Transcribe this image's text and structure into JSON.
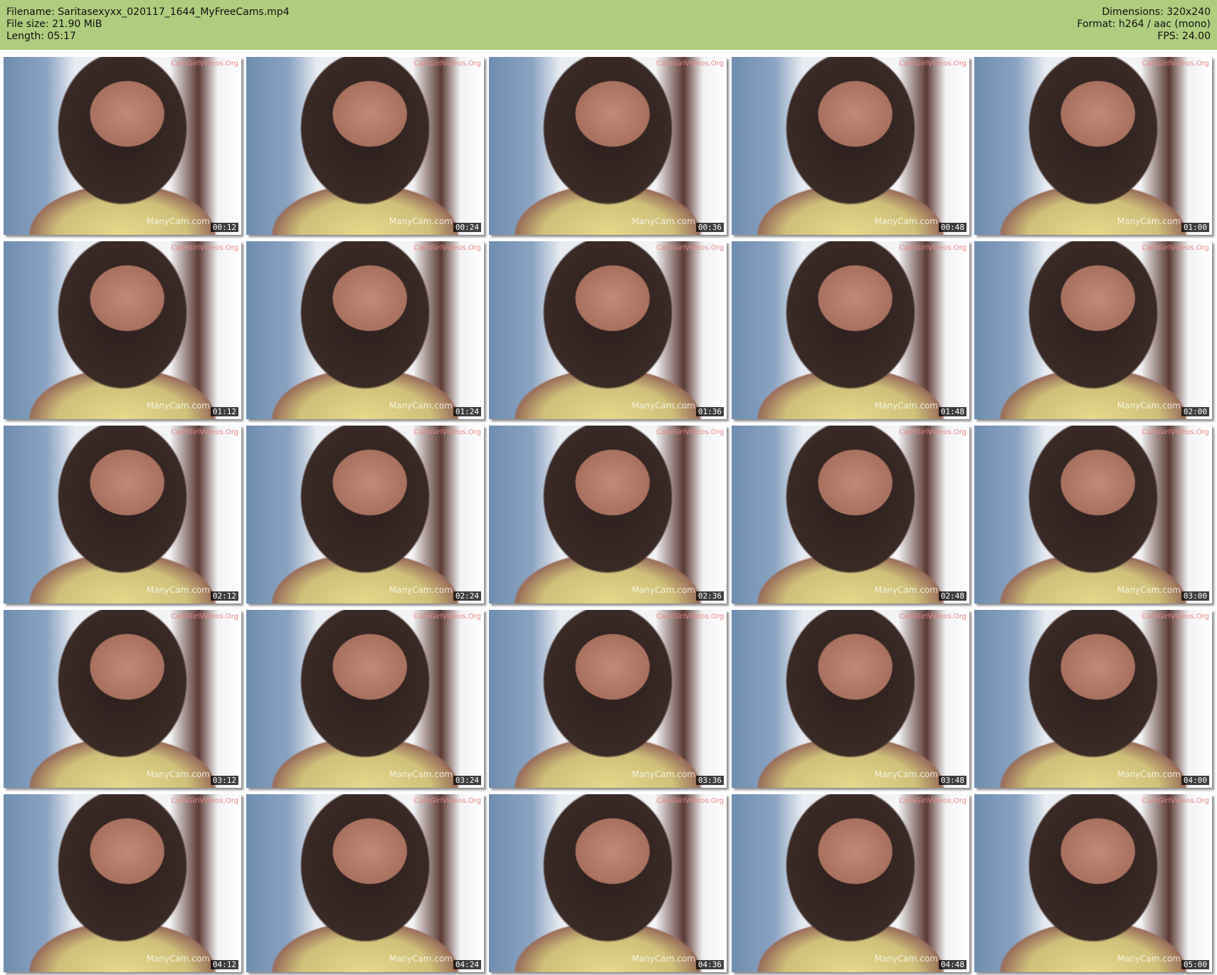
{
  "header": {
    "filename": "Filename: Saritasexyxx_020117_1644_MyFreeCams.mp4",
    "file_size": "File size: 21.90 MiB",
    "length": "Length: 05:17",
    "dimensions": "Dimensions: 320x240",
    "format": "Format: h264 / aac (mono)",
    "fps": "FPS: 24.00"
  },
  "watermarks": {
    "top": "CamGirlVideos.Org",
    "bottom": "ManyCam.com"
  },
  "colors": {
    "header_bg": "#b0cc7e"
  },
  "thumbnails": [
    "00:12",
    "00:24",
    "00:36",
    "00:48",
    "01:00",
    "01:12",
    "01:24",
    "01:36",
    "01:48",
    "02:00",
    "02:12",
    "02:24",
    "02:36",
    "02:48",
    "03:00",
    "03:12",
    "03:24",
    "03:36",
    "03:48",
    "04:00",
    "04:12",
    "04:24",
    "04:36",
    "04:48",
    "05:00"
  ]
}
